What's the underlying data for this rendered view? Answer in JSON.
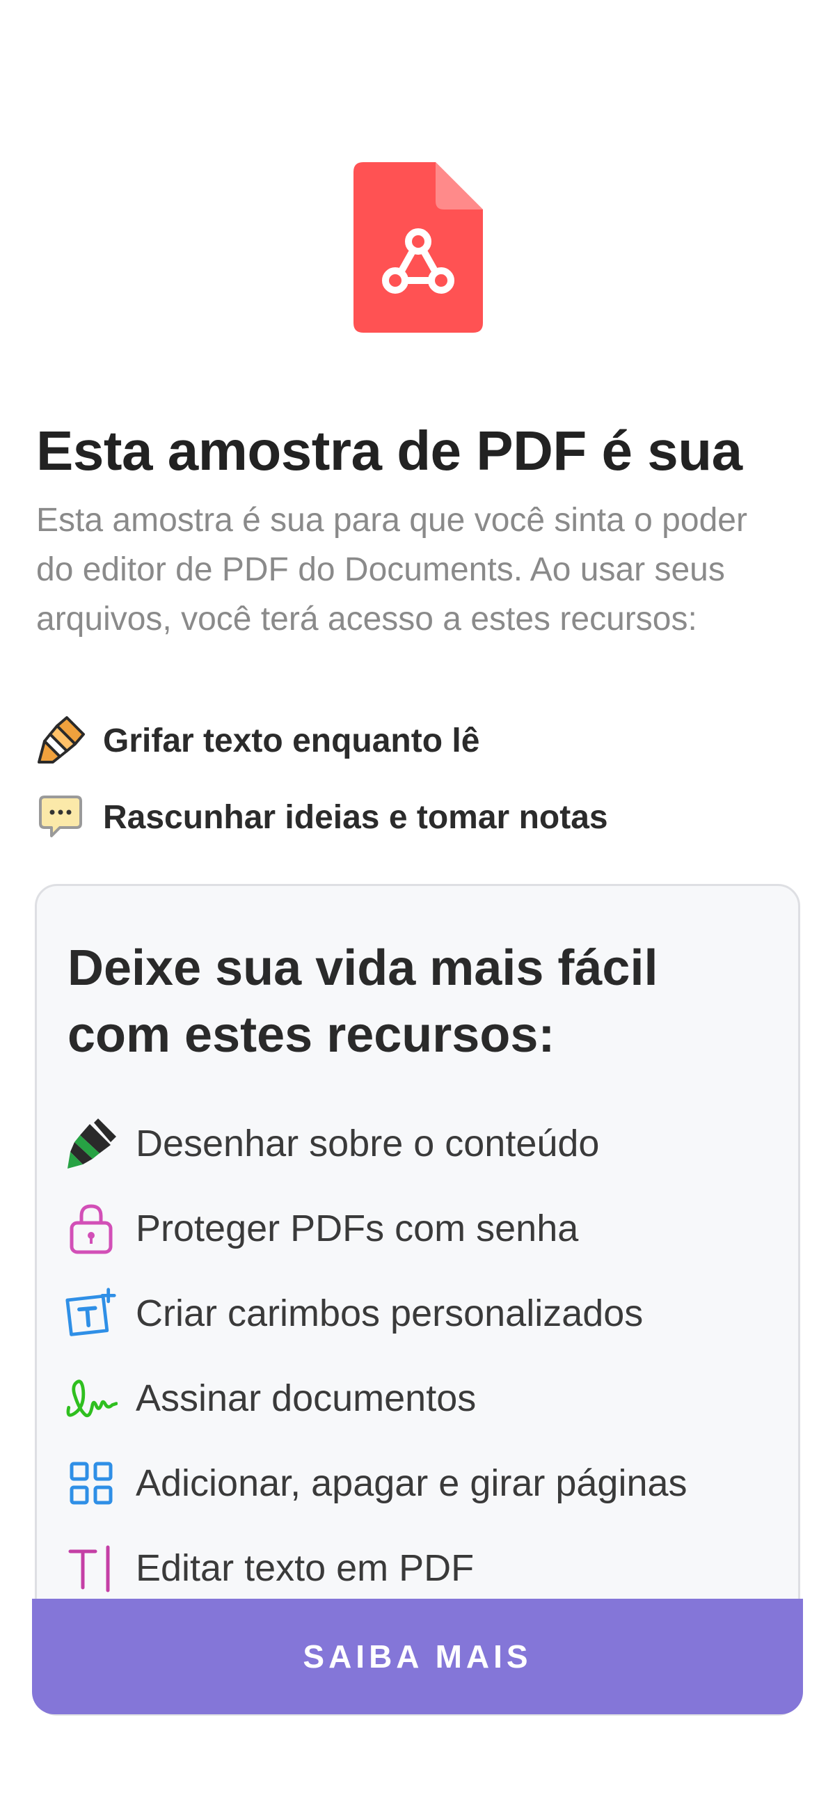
{
  "hero": {
    "icon": "pdf-file-icon",
    "icon_color": "#ff5253",
    "headline": "Esta amostra de PDF é sua",
    "description": "Esta amostra é sua para que você sinta o poder do editor de PDF do Documents. Ao usar seus arquivos, você terá acesso a estes recursos:"
  },
  "top_features": [
    {
      "icon": "highlighter-icon",
      "label": "Grifar texto enquanto lê"
    },
    {
      "icon": "speech-bubble-icon",
      "label": "Rascunhar ideias e tomar notas"
    }
  ],
  "card": {
    "title": "Deixe sua vida mais fácil com estes recursos:",
    "features": [
      {
        "icon": "marker-icon",
        "label": "Desenhar sobre o conteúdo",
        "color": "#27a244"
      },
      {
        "icon": "lock-icon",
        "label": "Proteger PDFs com senha",
        "color": "#d24fb7"
      },
      {
        "icon": "stamp-text-icon",
        "label": "Criar carimbos personalizados",
        "color": "#2f8fe6"
      },
      {
        "icon": "signature-icon",
        "label": "Assinar documentos",
        "color": "#2fbf1f"
      },
      {
        "icon": "grid-pages-icon",
        "label": "Adicionar, apagar e girar páginas",
        "color": "#2f8fe6"
      },
      {
        "icon": "text-cursor-icon",
        "label": "Editar texto em PDF",
        "color": "#c43fa5"
      }
    ]
  },
  "cta": {
    "label": "SAIBA MAIS",
    "color": "#8476d8"
  }
}
